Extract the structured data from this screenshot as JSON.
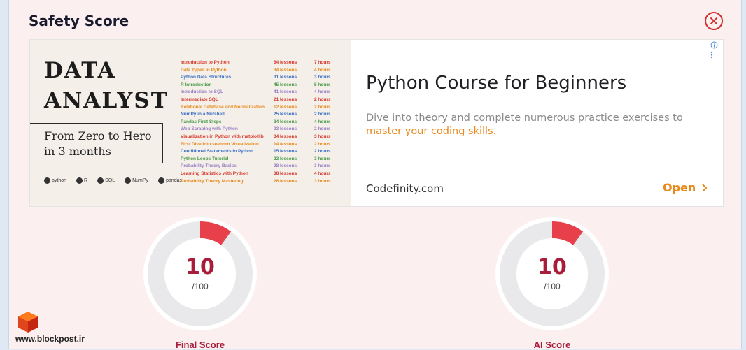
{
  "modal": {
    "title": "Safety Score"
  },
  "ad": {
    "image": {
      "headline_line1": "DATA",
      "headline_line2": "ANALYST",
      "box_line1": "From Zero to Hero",
      "box_line2": "in 3 months",
      "logos": [
        "python",
        "R",
        "SQL",
        "NumPy",
        "pandas"
      ],
      "courses": [
        {
          "name": "Introduction to Python",
          "lessons": "64 lessons",
          "hours": "7 hours",
          "color": "#d7382c"
        },
        {
          "name": "Data Types in Python",
          "lessons": "34 lessons",
          "hours": "4 hours",
          "color": "#e8891c"
        },
        {
          "name": "Python Data Structures",
          "lessons": "31 lessons",
          "hours": "3 hours",
          "color": "#3c6fc4"
        },
        {
          "name": "R Introduction",
          "lessons": "45 lessons",
          "hours": "5 hours",
          "color": "#4a9a4a"
        },
        {
          "name": "Introduction to SQL",
          "lessons": "41 lessons",
          "hours": "4 hours",
          "color": "#9a7fc6"
        },
        {
          "name": "Intermediate SQL",
          "lessons": "21 lessons",
          "hours": "2 hours",
          "color": "#d7382c"
        },
        {
          "name": "Relational Database and Normalization",
          "lessons": "12 lessons",
          "hours": "2 hours",
          "color": "#e8891c"
        },
        {
          "name": "NumPy in a Nutshell",
          "lessons": "25 lessons",
          "hours": "2 hours",
          "color": "#3c6fc4"
        },
        {
          "name": "Pandas First Steps",
          "lessons": "34 lessons",
          "hours": "4 hours",
          "color": "#4a9a4a"
        },
        {
          "name": "Web Scraping with Python",
          "lessons": "23 lessons",
          "hours": "2 hours",
          "color": "#9a7fc6"
        },
        {
          "name": "Visualization in Python with matplotlib",
          "lessons": "34 lessons",
          "hours": "3 hours",
          "color": "#d7382c"
        },
        {
          "name": "First Dive into seaborn Visualization",
          "lessons": "14 lessons",
          "hours": "2 hours",
          "color": "#e8891c"
        },
        {
          "name": "Conditional Statements in Python",
          "lessons": "15 lessons",
          "hours": "2 hours",
          "color": "#3c6fc4"
        },
        {
          "name": "Python Loops Tutorial",
          "lessons": "22 lessons",
          "hours": "3 hours",
          "color": "#4a9a4a"
        },
        {
          "name": "Probability Theory Basics",
          "lessons": "28 lessons",
          "hours": "3 hours",
          "color": "#9a7fc6"
        },
        {
          "name": "Learning Statistics with Python",
          "lessons": "38 lessons",
          "hours": "4 hours",
          "color": "#d7382c"
        },
        {
          "name": "Probability Theory Mastering",
          "lessons": "26 lessons",
          "hours": "3 hours",
          "color": "#e8891c"
        }
      ]
    },
    "title": "Python Course for Beginners",
    "description_plain": "Dive into theory and complete numerous practice exercises to ",
    "description_accent": "master your coding skills.",
    "domain": "Codefinity.com",
    "cta": "Open"
  },
  "scores": {
    "final": {
      "value": "10",
      "max": "/100",
      "fraction": 0.1,
      "label": "Final Score"
    },
    "ai": {
      "value": "10",
      "max": "/100",
      "fraction": 0.1,
      "label": "AI Score"
    }
  },
  "watermark": {
    "text": "www.blockpost.ir"
  },
  "colors": {
    "accent": "#e8891c",
    "score": "#a71d3a",
    "gauge_fill": "#e8404a",
    "close": "#d32f2f"
  }
}
